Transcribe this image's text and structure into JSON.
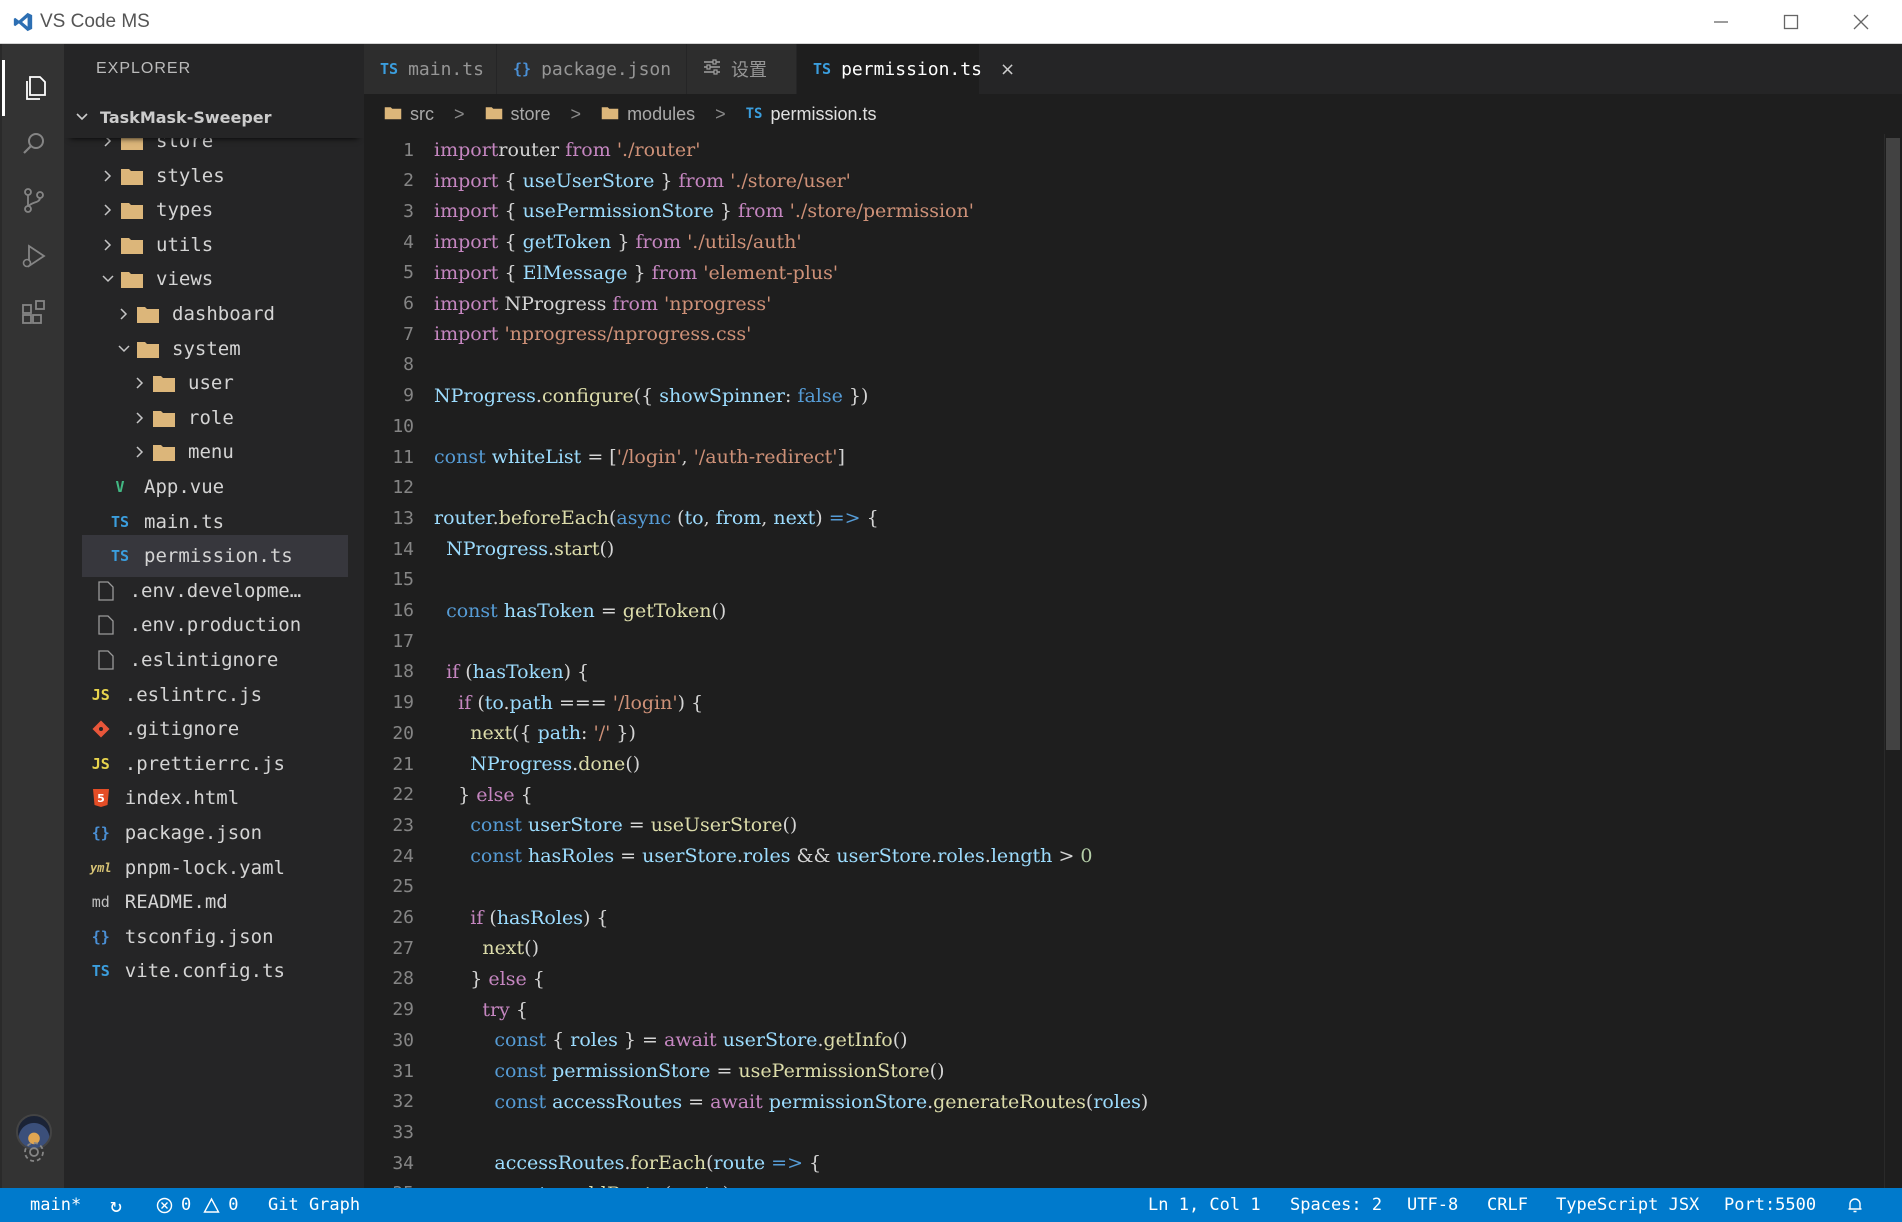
{
  "window": {
    "title": "VS Code MS"
  },
  "sidebar": {
    "title": "EXPLORER",
    "project": "TaskMask-Sweeper",
    "tree": [
      {
        "label": "store",
        "kind": "folder",
        "expanded": false
      },
      {
        "label": "styles",
        "kind": "folder",
        "expanded": false
      },
      {
        "label": "types",
        "kind": "folder",
        "expanded": false
      },
      {
        "label": "utils",
        "kind": "folder",
        "expanded": false
      },
      {
        "label": "views",
        "kind": "folder",
        "expanded": true
      },
      {
        "label": "dashboard",
        "kind": "folder",
        "expanded": false
      },
      {
        "label": "system",
        "kind": "folder",
        "expanded": true
      },
      {
        "label": "user",
        "kind": "folder",
        "expanded": false
      },
      {
        "label": "role",
        "kind": "folder",
        "expanded": false
      },
      {
        "label": "menu",
        "kind": "folder",
        "expanded": false
      },
      {
        "label": "App.vue",
        "kind": "vue",
        "icon_text": "V"
      },
      {
        "label": "main.ts",
        "kind": "ts",
        "icon_text": "TS"
      },
      {
        "label": "permission.ts",
        "kind": "ts",
        "icon_text": "TS",
        "selected": true
      },
      {
        "label": ".env.developme…",
        "kind": "file"
      },
      {
        "label": ".env.production",
        "kind": "file"
      },
      {
        "label": ".eslintignore",
        "kind": "file"
      },
      {
        "label": ".eslintrc.js",
        "kind": "js",
        "icon_text": "JS"
      },
      {
        "label": ".gitignore",
        "kind": "git"
      },
      {
        "label": ".prettierrc.js",
        "kind": "js",
        "icon_text": "JS"
      },
      {
        "label": "index.html",
        "kind": "html",
        "icon_text": "5"
      },
      {
        "label": "package.json",
        "kind": "json",
        "icon_text": "{}"
      },
      {
        "label": "pnpm-lock.yaml",
        "kind": "yml",
        "icon_text": "yml"
      },
      {
        "label": "README.md",
        "kind": "md",
        "icon_text": "md"
      },
      {
        "label": "tsconfig.json",
        "kind": "json",
        "icon_text": "{}"
      },
      {
        "label": "vite.config.ts",
        "kind": "ts",
        "icon_text": "TS"
      }
    ]
  },
  "tabs": [
    {
      "icon_text": "TS",
      "icon_kind": "ts",
      "label": "main.ts",
      "active": false
    },
    {
      "icon_text": "{}",
      "icon_kind": "json",
      "label": "package.json",
      "active": false
    },
    {
      "icon_text": "",
      "icon_kind": "settings",
      "label": "设置",
      "active": false
    },
    {
      "icon_text": "TS",
      "icon_kind": "ts",
      "label": "permission.ts",
      "active": true,
      "close": "×"
    }
  ],
  "breadcrumb": {
    "items": [
      "src",
      "store",
      "modules",
      "permission.ts"
    ],
    "file_icon_text": "TS",
    "separator": ">"
  },
  "editor": {
    "lines": [
      [
        [
          "kw",
          "import"
        ],
        [
          "",
          "router"
        ],
        [
          "kw",
          " from"
        ],
        [
          "st",
          " './router'"
        ]
      ],
      [
        [
          "kw",
          "import"
        ],
        [
          "",
          " { "
        ],
        [
          "vr",
          "useUserStore"
        ],
        [
          "",
          " } "
        ],
        [
          "kw",
          "from"
        ],
        [
          "st",
          " './store/user'"
        ]
      ],
      [
        [
          "kw",
          "import"
        ],
        [
          "",
          " { "
        ],
        [
          "vr",
          "usePermissionStore"
        ],
        [
          "",
          " } "
        ],
        [
          "kw",
          "from"
        ],
        [
          "st",
          " './store/permission'"
        ]
      ],
      [
        [
          "kw",
          "import"
        ],
        [
          "",
          " { "
        ],
        [
          "vr",
          "getToken"
        ],
        [
          "",
          " } "
        ],
        [
          "kw",
          "from"
        ],
        [
          "st",
          " './utils/auth'"
        ]
      ],
      [
        [
          "kw",
          "import"
        ],
        [
          "",
          " { "
        ],
        [
          "vr",
          "ElMessage"
        ],
        [
          "",
          " } "
        ],
        [
          "kw",
          "from"
        ],
        [
          "st",
          " 'element-plus'"
        ]
      ],
      [
        [
          "kw",
          "import"
        ],
        [
          "",
          " NProgress "
        ],
        [
          "kw",
          "from"
        ],
        [
          "st",
          " 'nprogress'"
        ]
      ],
      [
        [
          "kw",
          "import"
        ],
        [
          "st",
          " 'nprogress/nprogress.css'"
        ]
      ],
      [],
      [
        [
          "vr",
          "NProgress"
        ],
        [
          "",
          "."
        ],
        [
          "fn",
          "configure"
        ],
        [
          "",
          "({ "
        ],
        [
          "vr",
          "showSpinner"
        ],
        [
          "",
          ": "
        ],
        [
          "kd",
          "false"
        ],
        [
          "",
          " })"
        ]
      ],
      [],
      [
        [
          "kd",
          "const"
        ],
        [
          "vr",
          " whiteList"
        ],
        [
          "",
          " = ["
        ],
        [
          "st",
          "'/login'"
        ],
        [
          "",
          ", "
        ],
        [
          "st",
          "'/auth-redirect'"
        ],
        [
          "",
          "]"
        ]
      ],
      [],
      [
        [
          "vr",
          "router"
        ],
        [
          "",
          "."
        ],
        [
          "fn",
          "beforeEach"
        ],
        [
          "",
          "("
        ],
        [
          "kd",
          "async"
        ],
        [
          "",
          " ("
        ],
        [
          "vr",
          "to"
        ],
        [
          "",
          ", "
        ],
        [
          "vr",
          "from"
        ],
        [
          "",
          ", "
        ],
        [
          "vr",
          "next"
        ],
        [
          "",
          ") "
        ],
        [
          "kd",
          "=>"
        ],
        [
          "",
          " {"
        ]
      ],
      [
        [
          "",
          "  "
        ],
        [
          "vr",
          "NProgress"
        ],
        [
          "",
          "."
        ],
        [
          "fn",
          "start"
        ],
        [
          "",
          "()"
        ]
      ],
      [],
      [
        [
          "",
          "  "
        ],
        [
          "kd",
          "const"
        ],
        [
          "vr",
          " hasToken"
        ],
        [
          "",
          " = "
        ],
        [
          "fn",
          "getToken"
        ],
        [
          "",
          "()"
        ]
      ],
      [],
      [
        [
          "",
          "  "
        ],
        [
          "kw",
          "if"
        ],
        [
          "",
          " ("
        ],
        [
          "vr",
          "hasToken"
        ],
        [
          "",
          ") {"
        ]
      ],
      [
        [
          "",
          "    "
        ],
        [
          "kw",
          "if"
        ],
        [
          "",
          " ("
        ],
        [
          "vr",
          "to"
        ],
        [
          "",
          "."
        ],
        [
          "vr",
          "path"
        ],
        [
          "",
          " === "
        ],
        [
          "st",
          "'/login'"
        ],
        [
          "",
          ") {"
        ]
      ],
      [
        [
          "",
          "      "
        ],
        [
          "fn",
          "next"
        ],
        [
          "",
          "({ "
        ],
        [
          "vr",
          "path"
        ],
        [
          "",
          ": "
        ],
        [
          "st",
          "'/'"
        ],
        [
          "",
          " })"
        ]
      ],
      [
        [
          "",
          "      "
        ],
        [
          "vr",
          "NProgress"
        ],
        [
          "",
          "."
        ],
        [
          "fn",
          "done"
        ],
        [
          "",
          "()"
        ]
      ],
      [
        [
          "",
          "    } "
        ],
        [
          "kw",
          "else"
        ],
        [
          "",
          " {"
        ]
      ],
      [
        [
          "",
          "      "
        ],
        [
          "kd",
          "const"
        ],
        [
          "vr",
          " userStore"
        ],
        [
          "",
          " = "
        ],
        [
          "fn",
          "useUserStore"
        ],
        [
          "",
          "()"
        ]
      ],
      [
        [
          "",
          "      "
        ],
        [
          "kd",
          "const"
        ],
        [
          "vr",
          " hasRoles"
        ],
        [
          "",
          " = "
        ],
        [
          "vr",
          "userStore"
        ],
        [
          "",
          "."
        ],
        [
          "vr",
          "roles"
        ],
        [
          "",
          " && "
        ],
        [
          "vr",
          "userStore"
        ],
        [
          "",
          "."
        ],
        [
          "vr",
          "roles"
        ],
        [
          "",
          "."
        ],
        [
          "vr",
          "length"
        ],
        [
          "",
          " > "
        ],
        [
          "nm",
          "0"
        ]
      ],
      [],
      [
        [
          "",
          "      "
        ],
        [
          "kw",
          "if"
        ],
        [
          "",
          " ("
        ],
        [
          "vr",
          "hasRoles"
        ],
        [
          "",
          ") {"
        ]
      ],
      [
        [
          "",
          "        "
        ],
        [
          "fn",
          "next"
        ],
        [
          "",
          "()"
        ]
      ],
      [
        [
          "",
          "      } "
        ],
        [
          "kw",
          "else"
        ],
        [
          "",
          " {"
        ]
      ],
      [
        [
          "",
          "        "
        ],
        [
          "kw",
          "try"
        ],
        [
          "",
          " {"
        ]
      ],
      [
        [
          "",
          "          "
        ],
        [
          "kd",
          "const"
        ],
        [
          "",
          " { "
        ],
        [
          "vr",
          "roles"
        ],
        [
          "",
          " } = "
        ],
        [
          "kw",
          "await"
        ],
        [
          "vr",
          " userStore"
        ],
        [
          "",
          "."
        ],
        [
          "fn",
          "getInfo"
        ],
        [
          "",
          "()"
        ]
      ],
      [
        [
          "",
          "          "
        ],
        [
          "kd",
          "const"
        ],
        [
          "vr",
          " permissionStore"
        ],
        [
          "",
          " = "
        ],
        [
          "fn",
          "usePermissionStore"
        ],
        [
          "",
          "()"
        ]
      ],
      [
        [
          "",
          "          "
        ],
        [
          "kd",
          "const"
        ],
        [
          "vr",
          " accessRoutes"
        ],
        [
          "",
          " = "
        ],
        [
          "kw",
          "await"
        ],
        [
          "vr",
          " permissionStore"
        ],
        [
          "",
          "."
        ],
        [
          "fn",
          "generateRoutes"
        ],
        [
          "",
          "("
        ],
        [
          "vr",
          "roles"
        ],
        [
          "",
          ")"
        ]
      ],
      [],
      [
        [
          "",
          "          "
        ],
        [
          "vr",
          "accessRoutes"
        ],
        [
          "",
          "."
        ],
        [
          "fn",
          "forEach"
        ],
        [
          "",
          "("
        ],
        [
          "vr",
          "route"
        ],
        [
          "",
          " "
        ],
        [
          "kd",
          "=>"
        ],
        [
          "",
          " {"
        ]
      ],
      [
        [
          "",
          "            "
        ],
        [
          "vr",
          "router"
        ],
        [
          "",
          "."
        ],
        [
          "fn",
          "addRoute"
        ],
        [
          "",
          "("
        ],
        [
          "vr",
          "route"
        ],
        [
          "",
          ")"
        ]
      ]
    ]
  },
  "statusbar": {
    "branch": "main*",
    "sync_icon": "↻",
    "errors": "0",
    "warnings": "0",
    "git_graph": "Git Graph",
    "position": "Ln 1, Col 1",
    "spaces": "Spaces: 2",
    "encoding": "UTF-8",
    "eol": "CRLF",
    "language": "TypeScript JSX",
    "port": "Port:5500"
  },
  "colors": {
    "accent": "#007acc",
    "folder": "#dcb67a",
    "ts": "#3b9ede",
    "js": "#e8d44d",
    "vue": "#42b883",
    "html": "#e44d26",
    "git": "#e8563a"
  }
}
